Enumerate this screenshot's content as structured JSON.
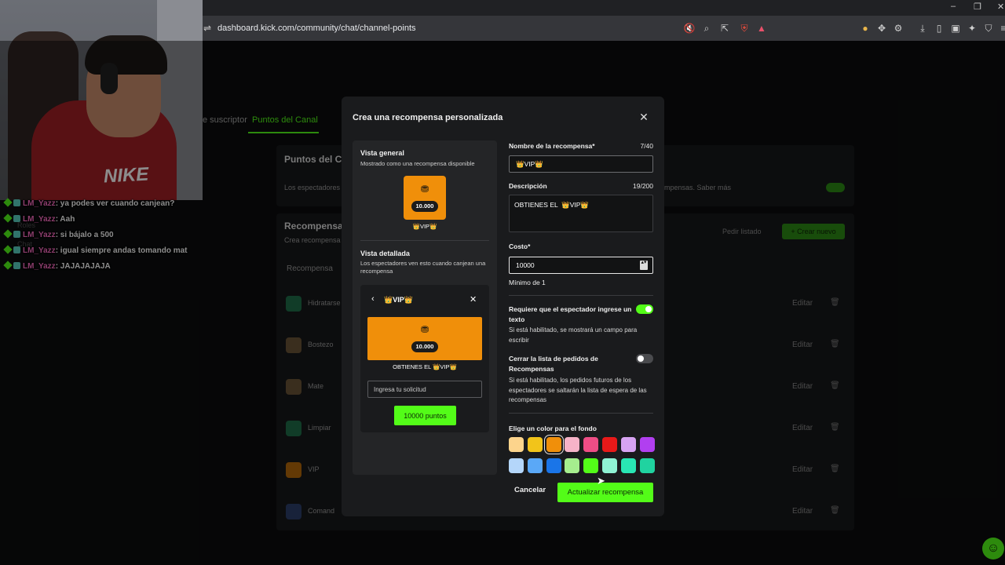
{
  "browser": {
    "url": "dashboard.kick.com/community/chat/channel-points",
    "window_controls": [
      "–",
      "❐",
      "✕"
    ]
  },
  "page": {
    "tabs": [
      "e suscriptor",
      "Puntos del Canal"
    ],
    "panel_title": "Puntos del Ca",
    "panel_text": "Los espectadores",
    "panel_text_right": "mpensas. Saber más",
    "rewards_title": "Recompensas",
    "rewards_sub": "Crea recompensa",
    "rewards_col": "Recompensa",
    "pedir_listado": "Pedir listado",
    "crear_nuevo": "+ Crear nuevo",
    "edit_label": "Editar",
    "rewards": [
      {
        "name": "Hidratarse",
        "color": "#1f6e4a"
      },
      {
        "name": "Bostezo",
        "color": "#6b5438"
      },
      {
        "name": "Mate",
        "color": "#6b5438"
      },
      {
        "name": "Limpiar",
        "color": "#1f6e4a"
      },
      {
        "name": "VIP",
        "color": "#b5690a"
      },
      {
        "name": "Comand",
        "color": "#2c3f6b"
      }
    ]
  },
  "chat": {
    "messages": [
      {
        "user": "LM_Yazz",
        "text": ": ya podes ver cuando canjean?"
      },
      {
        "user": "LM_Yazz",
        "text": ": Aah"
      },
      {
        "user": "LM_Yazz",
        "text": ": si bájalo a 500"
      },
      {
        "user": "LM_Yazz",
        "text": ": igual siempre andas tomando mat"
      },
      {
        "user": "LM_Yazz",
        "text": ": JAJAJAJAJA"
      }
    ],
    "ghost_roles": "Roles",
    "ghost_chat": "Chat"
  },
  "webcam": {
    "shirt_logo": "NIKE"
  },
  "modal": {
    "title": "Crea una recompensa personalizada",
    "preview": {
      "general_title": "Vista general",
      "general_sub": "Mostrado como una recompensa disponible",
      "cost_pill": "10.000",
      "reward_caption": "👑VIP👑",
      "detail_title": "Vista detallada",
      "detail_sub": "Los espectadores ven esto cuando canjean una recompensa",
      "detail_name": "👑VIP👑",
      "detail_desc": "OBTIENES EL 👑VIP👑",
      "input_placeholder": "Ingresa tu solicitud",
      "button_label": "10000 puntos"
    },
    "form": {
      "name_label": "Nombre de la recompensa*",
      "name_count": "7/40",
      "name_value": "👑VIP👑",
      "desc_label": "Descripción",
      "desc_count": "19/200",
      "desc_value": "OBTIENES EL  👑VIP👑",
      "cost_label": "Costo*",
      "cost_value": "10000",
      "cost_min": "Mínimo de 1",
      "require_label": "Requiere que el espectador ingrese un texto",
      "require_help": "Si está habilitado, se mostrará un campo para escribir",
      "require_on": true,
      "close_label": "Cerrar la lista de pedidos de Recompensas",
      "close_help": "Si está habilitado, los pedidos futuros de los espectadores se saltarán la lista de espera de las recompensas",
      "close_on": false,
      "color_label": "Elige un color para el fondo",
      "colors_row1": [
        "#fcd48c",
        "#f2c41a",
        "#f08f0a",
        "#f6b3c8",
        "#ee4d85",
        "#e81919",
        "#d7a3f2",
        "#b13ff0"
      ],
      "colors_row2": [
        "#b4d6fa",
        "#5aa8f7",
        "#1a75e8",
        "#a6ee8e",
        "#53fc18",
        "#8ff3d4",
        "#29e6b4",
        "#20d3a0"
      ],
      "selected_color": "#f08f0a"
    },
    "cancel_label": "Cancelar",
    "submit_label": "Actualizar recompensa"
  }
}
